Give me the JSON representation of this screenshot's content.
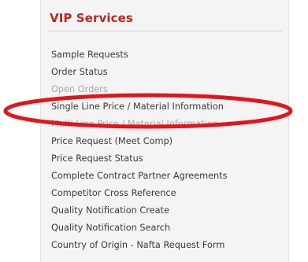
{
  "panel": {
    "title": "VIP Services",
    "items": [
      {
        "label": "Sample Requests"
      },
      {
        "label": "Order Status"
      },
      {
        "label": "Open Orders"
      },
      {
        "label": "Single Line Price / Material Information"
      },
      {
        "label": "Multi Line Price / Material Information"
      },
      {
        "label": "Price Request (Meet Comp)"
      },
      {
        "label": "Price Request Status"
      },
      {
        "label": "Complete Contract Partner Agreements"
      },
      {
        "label": "Competitor Cross Reference"
      },
      {
        "label": "Quality Notification Create"
      },
      {
        "label": "Quality Notification Search"
      },
      {
        "label": "Country of Origin - Nafta Request Form"
      }
    ]
  },
  "colors": {
    "title": "#c4241d",
    "highlight": "#e3141b",
    "item_text": "#3a3a3a",
    "panel_bg": "#f4f4f4"
  },
  "annotation": {
    "shape": "ellipse",
    "highlighted_item": 3
  }
}
